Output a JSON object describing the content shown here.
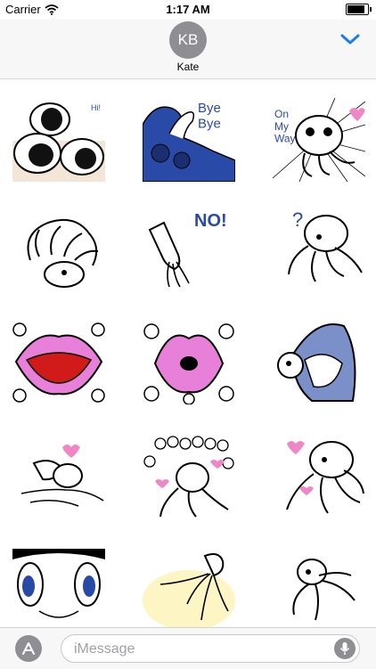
{
  "status": {
    "carrier": "Carrier",
    "time": "1:17 AM",
    "battery_level": 0.95
  },
  "header": {
    "avatar_initials": "KB",
    "contact_name": "Kate"
  },
  "stickers": [
    {
      "name": "sticker-octopus-hi",
      "text": "Hi!"
    },
    {
      "name": "sticker-octopus-bye-bye",
      "text": "Bye Bye"
    },
    {
      "name": "sticker-octopus-on-my-way",
      "text": "On My Way"
    },
    {
      "name": "sticker-octopus-tentacles",
      "text": ""
    },
    {
      "name": "sticker-squid-no",
      "text": "NO!"
    },
    {
      "name": "sticker-octopus-question",
      "text": "?"
    },
    {
      "name": "sticker-lips-tongue",
      "text": ""
    },
    {
      "name": "sticker-lips-kiss",
      "text": ""
    },
    {
      "name": "sticker-shark-octopus",
      "text": ""
    },
    {
      "name": "sticker-squid-octopus-heart",
      "text": ""
    },
    {
      "name": "sticker-octopus-eggs-hearts",
      "text": ""
    },
    {
      "name": "sticker-octopus-hearts",
      "text": ""
    },
    {
      "name": "sticker-octopus-eyes",
      "text": ""
    },
    {
      "name": "sticker-squid-sunburst",
      "text": ""
    },
    {
      "name": "sticker-octopus-crawling",
      "text": ""
    }
  ],
  "input": {
    "placeholder": "iMessage"
  },
  "icons": {
    "wifi": "wifi-icon",
    "battery": "battery-icon",
    "chevron": "chevron-down-icon",
    "appstore": "app-store-icon",
    "mic": "microphone-icon"
  },
  "colors": {
    "accent": "#1a7cf5",
    "avatar": "#8e8e93",
    "sticker_blue": "#2a4aa8",
    "sticker_pink": "#e87fd8"
  }
}
